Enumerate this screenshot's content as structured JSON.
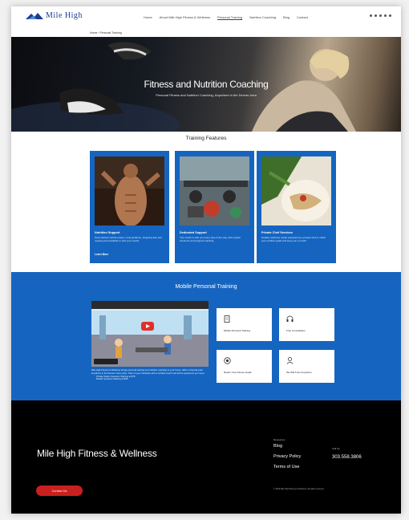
{
  "header": {
    "logo_text": "Mile High",
    "nav": [
      "Home",
      "About Mile High Fitness & Wellness",
      "Personal Training",
      "Nutrition Coaching",
      "Blog",
      "Contact"
    ],
    "active_nav_index": 2
  },
  "breadcrumb": "Home › Personal Training",
  "hero": {
    "title": "Fitness and Nutrition Coaching",
    "subtitle": "Personal Fitness and Nutrition Coaching, Anywhere in the Denver Area"
  },
  "features": {
    "title": "Training Features",
    "cards": [
      {
        "title": "Nutrition Support",
        "desc": "Personalized nutrition plans, meal guidance, shopping lists and ongoing accountability to fuel your results.",
        "link": "Learn More"
      },
      {
        "title": "Dedicated Support",
        "desc": "Your coach is with you every step of the way, with regular check-ins and progress tracking.",
        "link": ""
      },
      {
        "title": "Private Chef Services",
        "desc": "Healthy, delicious meals prepared by a private chef to match your nutrition goals and keep you on track.",
        "link": ""
      }
    ]
  },
  "mobile": {
    "title": "Mobile Personal Training",
    "video_label": "Watch on YouTube",
    "text": "Mile High Fitness & Wellness brings personal training and nutrition coaching to your home, office or favorite park anywhere in the Denver metro area. Train on your schedule with a certified coach and all the equipment you need.",
    "bullets": [
      "Private Studio Sessions Starting at $75",
      "Mobile Sessions Starting at $95"
    ],
    "services": [
      {
        "label": "Mobile Personal Training",
        "icon": "document-icon"
      },
      {
        "label": "Free Consultation",
        "icon": "headset-icon"
      },
      {
        "label": "Reach Your Fitness Goals",
        "icon": "target-icon"
      },
      {
        "label": "We Will Train Anywhere",
        "icon": "person-icon"
      }
    ]
  },
  "footer": {
    "brand": "Mile High Fitness & Wellness",
    "cta": "Contact Us",
    "links_heading": "Resources",
    "links": [
      "Blog",
      "Privacy Policy",
      "Terms of Use"
    ],
    "call_heading": "Call Us",
    "phone": "303.558.3806",
    "copyright": "© 2023 Mile High Fitness & Wellness. All rights reserved."
  },
  "colors": {
    "brand_blue": "#1565c0",
    "cta_red": "#c8201e",
    "footer_bg": "#000000"
  }
}
